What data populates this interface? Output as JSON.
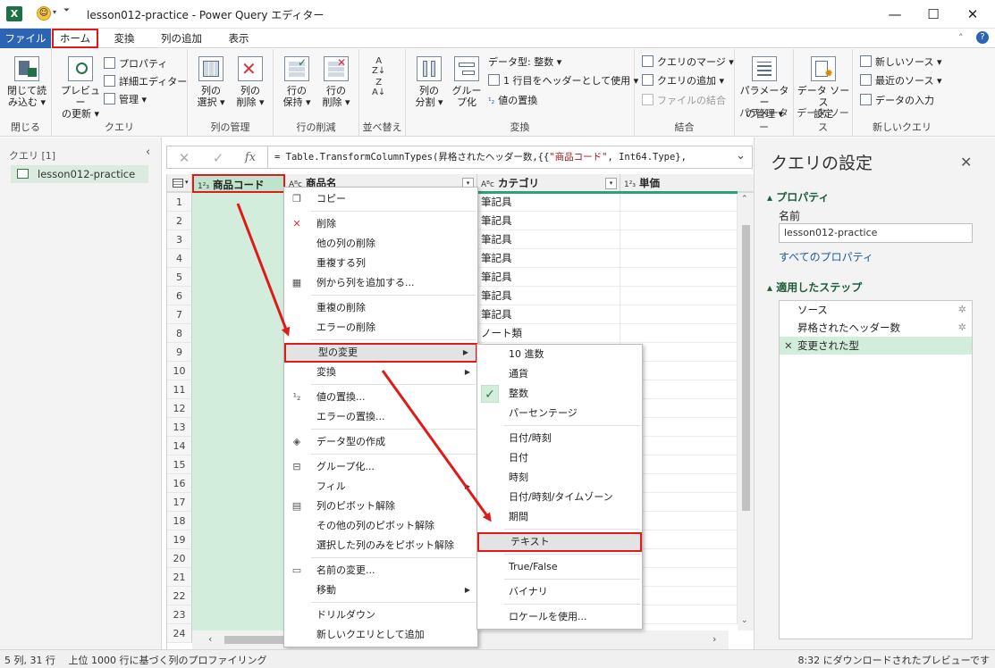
{
  "window": {
    "app_icon": "X",
    "title": "lesson012-practice - Power Query エディター",
    "minimize": "—",
    "maximize": "☐",
    "close": "✕"
  },
  "tabs": [
    "ファイル",
    "ホーム",
    "変換",
    "列の追加",
    "表示"
  ],
  "ribbon": {
    "close_load": "閉じて読み込む",
    "close_load_line1": "閉じて読",
    "close_load_line2": "み込む ▾",
    "group_close": "閉じる",
    "preview_refresh_line1": "プレビュー",
    "preview_refresh_line2": "の更新 ▾",
    "properties": "プロパティ",
    "advanced_editor": "詳細エディター",
    "manage": "管理 ▾",
    "group_query": "クエリ",
    "choose_columns_line1": "列の",
    "choose_columns_line2": "選択 ▾",
    "remove_columns_line1": "列の",
    "remove_columns_line2": "削除 ▾",
    "group_manage_columns": "列の管理",
    "keep_rows_line1": "行の",
    "keep_rows_line2": "保持 ▾",
    "remove_rows_line1": "行の",
    "remove_rows_line2": "削除 ▾",
    "group_reduce_rows": "行の削減",
    "group_sort": "並べ替え",
    "split_column_line1": "列の",
    "split_column_line2": "分割 ▾",
    "group_by_line1": "グルー",
    "group_by_line2": "プ化",
    "data_type": "データ型: 整数 ▾",
    "use_first_row": "1 行目をヘッダーとして使用 ▾",
    "replace_values": "値の置換",
    "group_transform": "変換",
    "merge_queries": "クエリのマージ ▾",
    "append_queries": "クエリの追加 ▾",
    "combine_files": "ファイルの結合",
    "group_combine": "結合",
    "manage_params_line1": "パラメーター",
    "manage_params_line2": "の管理 ▾",
    "group_params": "パラメーター",
    "data_source_line1": "データ ソース",
    "data_source_line2": "設定",
    "group_data_sources": "データ ソース",
    "new_source": "新しいソース ▾",
    "recent_sources": "最近のソース ▾",
    "enter_data": "データの入力",
    "group_new_query": "新しいクエリ"
  },
  "queries_pane": {
    "header": "クエリ [1]",
    "collapse": "‹",
    "items": [
      "lesson012-practice"
    ]
  },
  "formula_bar": {
    "cancel": "✕",
    "accept": "✓",
    "fx": "fx",
    "prefix": "= Table.TransformColumnTypes(昇格されたヘッダー数,{{",
    "string": "\"商品コード\"",
    "suffix": ", Int64.Type},",
    "expand": "⌄"
  },
  "grid": {
    "columns": [
      {
        "type": "1²₃",
        "name": "商品コード"
      },
      {
        "type": "Aᴮc",
        "name": "商品名"
      },
      {
        "type": "Aᴮc",
        "name": "カテゴリ"
      },
      {
        "type": "1²₃",
        "name": "単価"
      }
    ],
    "row_numbers": [
      "1",
      "2",
      "3",
      "4",
      "5",
      "6",
      "7",
      "8",
      "9",
      "10",
      "11",
      "12",
      "13",
      "14",
      "15",
      "16",
      "17",
      "18",
      "19",
      "20",
      "21",
      "22",
      "23",
      "24"
    ],
    "category_values": [
      "筆記具",
      "筆記具",
      "筆記具",
      "筆記具",
      "筆記具",
      "筆記具",
      "筆記具",
      "ノート類"
    ]
  },
  "context_menu": {
    "items": [
      {
        "icon": "copy-icon",
        "glyph": "❐",
        "label": "コピー"
      },
      {
        "sep": true
      },
      {
        "icon": "delete-icon",
        "glyph": "✕",
        "label": "削除"
      },
      {
        "label": "他の列の削除"
      },
      {
        "label": "重複する列"
      },
      {
        "icon": "column-from-examples-icon",
        "glyph": "▦",
        "label": "例から列を追加する..."
      },
      {
        "sep": true
      },
      {
        "label": "重複の削除"
      },
      {
        "label": "エラーの削除"
      },
      {
        "sep": true
      },
      {
        "label": "型の変更",
        "submenu": true,
        "highlight": true
      },
      {
        "label": "変換",
        "submenu": true
      },
      {
        "sep": true
      },
      {
        "icon": "replace-values-icon",
        "glyph": "¹₂",
        "label": "値の置換..."
      },
      {
        "label": "エラーの置換..."
      },
      {
        "sep": true
      },
      {
        "icon": "create-data-type-icon",
        "glyph": "◈",
        "label": "データ型の作成"
      },
      {
        "sep": true
      },
      {
        "icon": "group-by-icon",
        "glyph": "⊟",
        "label": "グループ化..."
      },
      {
        "label": "フィル",
        "submenu": true
      },
      {
        "icon": "unpivot-icon",
        "glyph": "▤",
        "label": "列のピボット解除"
      },
      {
        "label": "その他の列のピボット解除"
      },
      {
        "label": "選択した列のみをピボット解除"
      },
      {
        "sep": true
      },
      {
        "icon": "rename-icon",
        "glyph": "▭",
        "label": "名前の変更..."
      },
      {
        "label": "移動",
        "submenu": true
      },
      {
        "sep": true
      },
      {
        "label": "ドリルダウン"
      },
      {
        "label": "新しいクエリとして追加"
      }
    ]
  },
  "type_submenu": {
    "items": [
      {
        "label": "10 進数"
      },
      {
        "label": "通貨"
      },
      {
        "label": "整数",
        "checked": true
      },
      {
        "label": "パーセンテージ"
      },
      {
        "sep": true
      },
      {
        "label": "日付/時刻"
      },
      {
        "label": "日付"
      },
      {
        "label": "時刻"
      },
      {
        "label": "日付/時刻/タイムゾーン"
      },
      {
        "label": "期間"
      },
      {
        "sep": true
      },
      {
        "label": "テキスト",
        "highlight": true
      },
      {
        "sep": true
      },
      {
        "label": "True/False"
      },
      {
        "sep": true
      },
      {
        "label": "バイナリ"
      },
      {
        "sep": true
      },
      {
        "label": "ロケールを使用..."
      }
    ]
  },
  "settings_pane": {
    "title": "クエリの設定",
    "close": "✕",
    "properties_header": "▴ プロパティ",
    "name_label": "名前",
    "name_value": "lesson012-practice",
    "all_properties": "すべてのプロパティ",
    "steps_header": "▴ 適用したステップ",
    "steps": [
      {
        "label": "ソース",
        "gear": true
      },
      {
        "label": "昇格されたヘッダー数",
        "gear": true
      },
      {
        "label": "変更された型",
        "selected": true
      }
    ]
  },
  "status": {
    "left": "5 列, 31 行　 上位 1000 行に基づく列のプロファイリング",
    "right": "8:32 にダウンロードされたプレビューです"
  },
  "colors": {
    "accent_green": "#217346",
    "selection_green": "#d3eddc",
    "highlight_red": "#e01919",
    "file_tab_blue": "#2b64b5"
  }
}
